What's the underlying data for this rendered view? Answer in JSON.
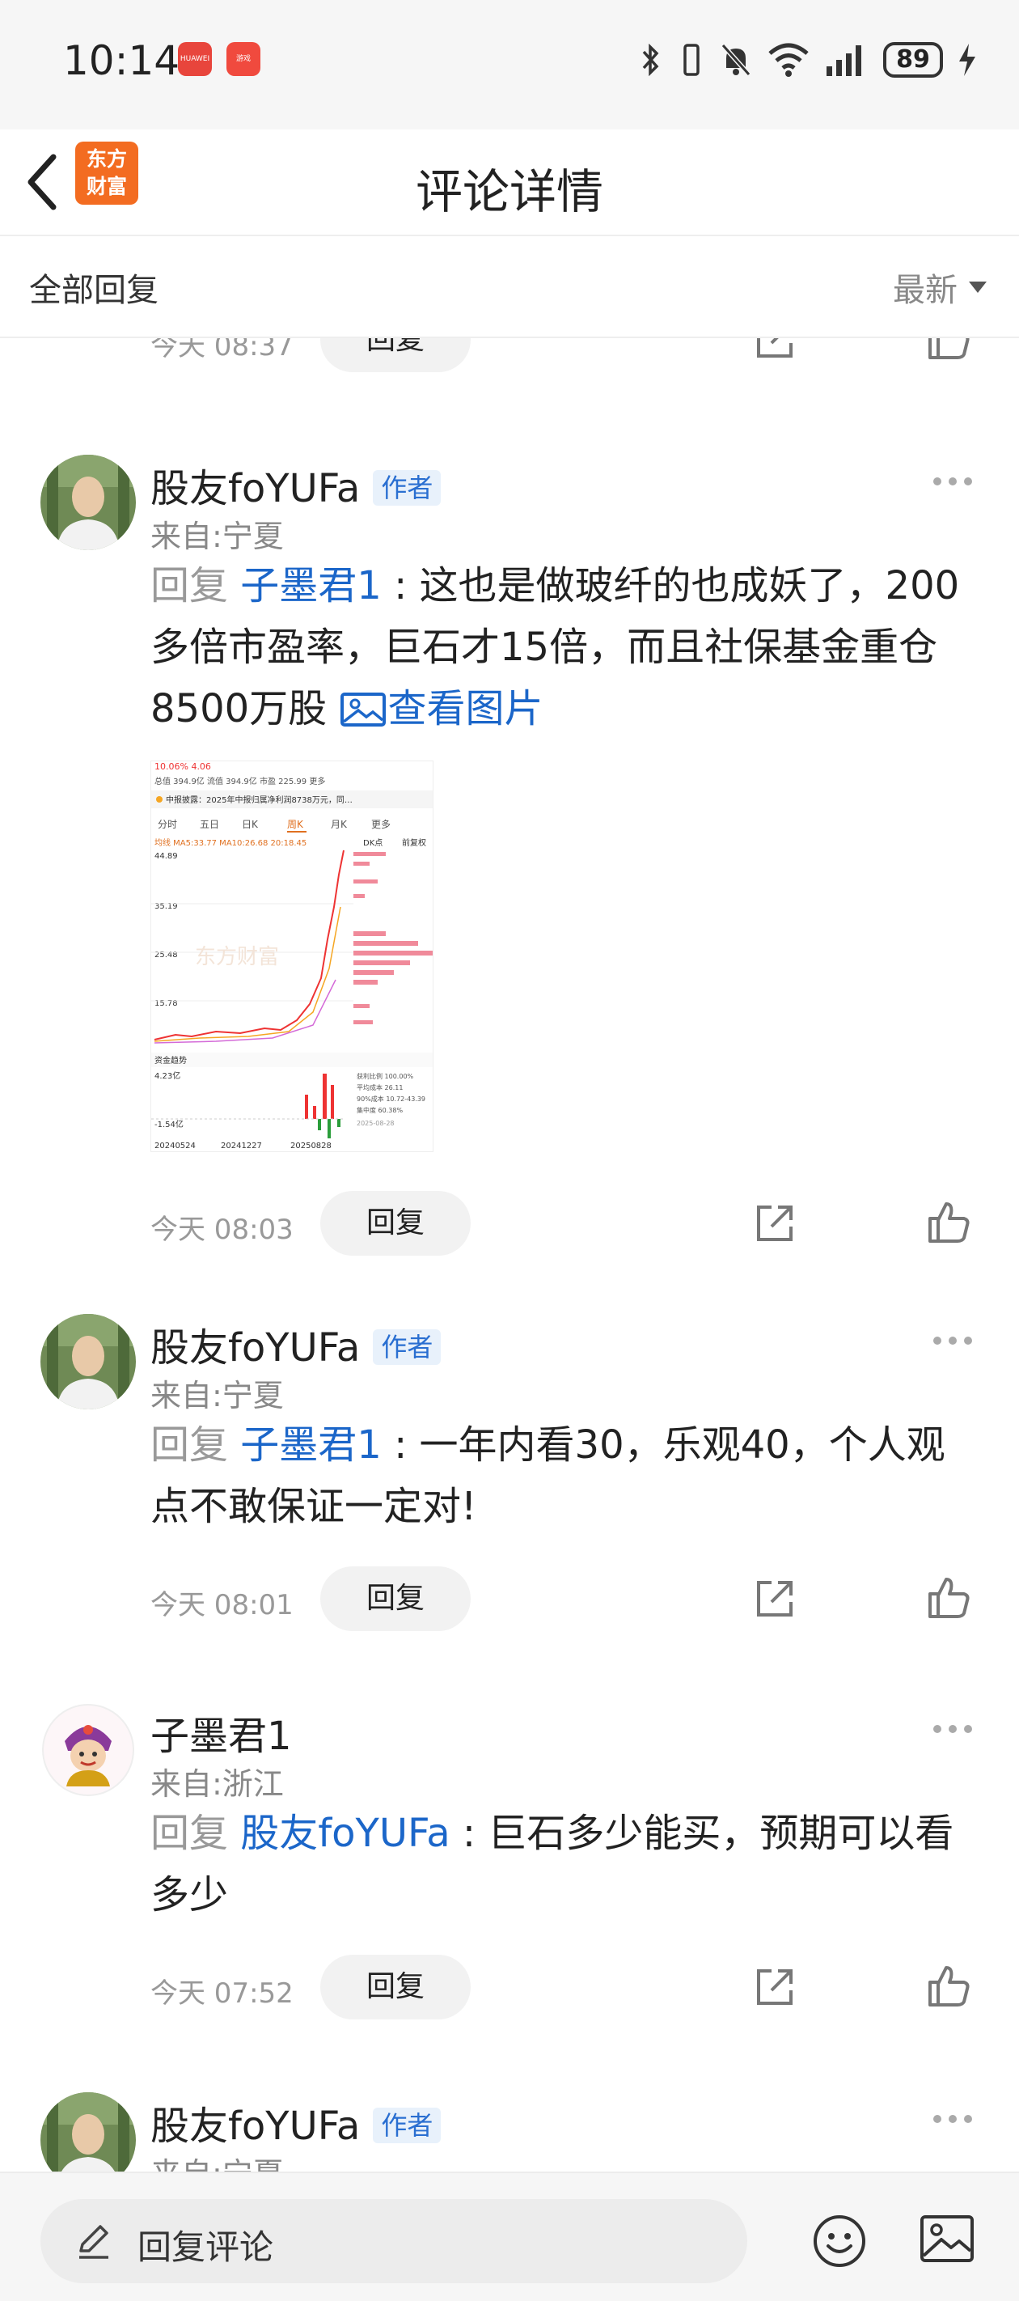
{
  "status_bar": {
    "time": "10:14",
    "battery": "89",
    "app1": "HUAWEI",
    "app2": "游戏"
  },
  "header": {
    "title": "评论详情",
    "logo_line1": "东方",
    "logo_line2": "财富"
  },
  "sort_bar": {
    "left_label": "全部回复",
    "right_label": "最新"
  },
  "common": {
    "reply_button": "回复",
    "reply_prefix": "回复",
    "author_badge": "作者"
  },
  "partial_top": {
    "time": "今天 08:37"
  },
  "comments": [
    {
      "username": "股友foYUFa",
      "location": "来自:宁夏",
      "reply_to": "子墨君1",
      "text": "这也是做玻纤的也成妖了，200多倍市盈率，巨石才15倍，而且社保基金重仓8500万股",
      "view_image": "查看图片",
      "time": "今天 08:03"
    },
    {
      "username": "股友foYUFa",
      "location": "来自:宁夏",
      "reply_to": "子墨君1",
      "text": "一年内看30，乐观40，个人观点不敢保证一定对!",
      "time": "今天 08:01"
    },
    {
      "username": "子墨君1",
      "location": "来自:浙江",
      "reply_to": "股友foYUFa",
      "text": "巨石多少能买，预期可以看多少",
      "time": "今天 07:52"
    },
    {
      "username": "股友foYUFa",
      "location": "来自:宁夏"
    }
  ],
  "stock_image": {
    "top_line": "10.06%  4.06",
    "mktcap": "总值 394.9亿  流值 394.9亿  市盈 225.99  更多",
    "notice": "中报披露：2025年中报归属净利润8738万元，同…",
    "tabs": [
      "分时",
      "五日",
      "日K",
      "周K",
      "月K",
      "更多"
    ],
    "ma_line": "均线 MA5:33.77  MA10:26.68  20:18.45",
    "right_labels": [
      "DK点",
      "前复权"
    ],
    "y_ticks": [
      "44.89",
      "35.19",
      "25.48",
      "15.78"
    ],
    "watermark": "东方财富",
    "flow_label": "资金趋势",
    "flow_vals": [
      "4.23亿",
      "-1.54亿"
    ],
    "dates": [
      "20240524",
      "20241227",
      "20250828"
    ],
    "stats": [
      "获利比例 100.00%",
      "平均成本 26.11",
      "90%成本 10.72-43.39",
      "集中度 60.38%",
      "2025-08-28"
    ]
  },
  "bottom_bar": {
    "input_placeholder": "回复评论"
  }
}
